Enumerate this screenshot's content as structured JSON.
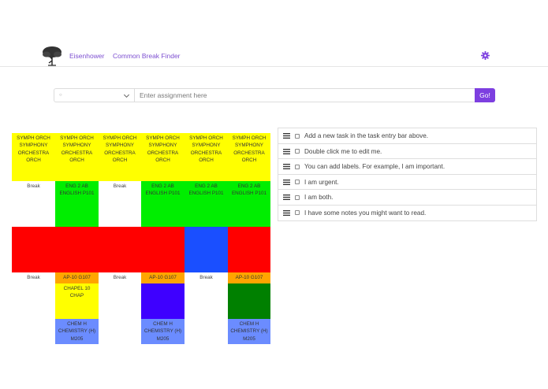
{
  "nav": {
    "brand": "Eisenhower",
    "common_break_finder": "Common Break Finder",
    "logo_icon": "tree-icon",
    "settings_icon": "gear-icon"
  },
  "entry": {
    "label_select_icon": "circle-icon",
    "placeholder": "Enter assignment here",
    "go_label": "Go!"
  },
  "colors": {
    "accent": "#7d3fe0",
    "link": "#7d4fd1"
  },
  "schedule": {
    "orch": [
      "SYMPH ORCH\nSYMPHONY\nORCHESTRA\nORCH",
      "SYMPH ORCH\nSYMPHONY\nORCHESTRA\nORCH",
      "SYMPH ORCH\nSYMPHONY\nORCHESTRA\nORCH",
      "SYMPH ORCH\nSYMPHONY\nORCHESTRA\nORCH",
      "SYMPH ORCH\nSYMPHONY\nORCHESTRA\nORCH",
      "SYMPH ORCH\nSYMPHONY\nORCHESTRA\nORCH"
    ],
    "break": "Break",
    "eng": "ENG 2 AB\nENGLISH P101",
    "ap": "AP-10 G107",
    "chapel": "CHAPEL 10\nCHAP",
    "chem": "CHEM H\nCHEMISTRY (H)\nM205"
  },
  "tasks": [
    {
      "text": "Add a new task in the task entry bar above."
    },
    {
      "text": "Double click me to edit me."
    },
    {
      "text": "You can add labels. For example, I am important."
    },
    {
      "text": "I am urgent."
    },
    {
      "text": "I am both."
    },
    {
      "text": "I have some notes you might want to read."
    }
  ]
}
